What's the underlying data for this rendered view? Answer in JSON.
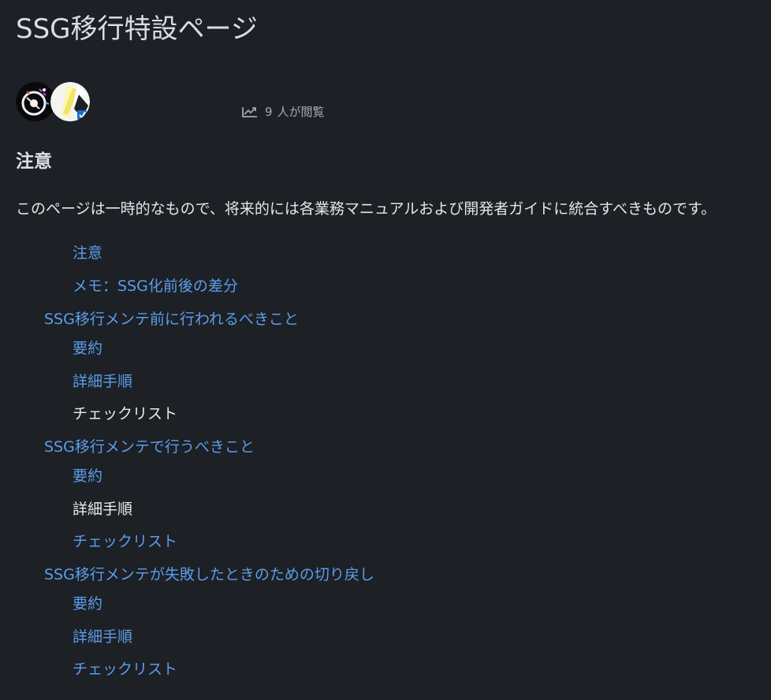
{
  "page": {
    "title": "SSG移行特設ページ"
  },
  "meta": {
    "view_count": "9",
    "view_suffix": "人が閲覧"
  },
  "notice": {
    "heading": "注意",
    "body": "このページは一時的なもので、将来的には各業務マニュアルおよび開発者ガイドに統合すべきものです。"
  },
  "toc": {
    "items": [
      {
        "label": "注意",
        "level": 2
      },
      {
        "label": "メモ：SSG化前後の差分",
        "level": 2
      },
      {
        "label": "SSG移行メンテ前に行われるべきこと",
        "level": 1
      },
      {
        "label": "要約",
        "level": 2
      },
      {
        "label": "詳細手順",
        "level": 2
      },
      {
        "label": "チェックリスト",
        "level": 2
      },
      {
        "label": "SSG移行メンテで行うべきこと",
        "level": 1
      },
      {
        "label": "要約",
        "level": 2
      },
      {
        "label": "詳細手順",
        "level": 2
      },
      {
        "label": "チェックリスト",
        "level": 2
      },
      {
        "label": "SSG移行メンテが失敗したときのための切り戻し",
        "level": 1
      },
      {
        "label": "要約",
        "level": 2
      },
      {
        "label": "詳細手順",
        "level": 2
      },
      {
        "label": "チェックリスト",
        "level": 2
      }
    ]
  },
  "colors": {
    "background": "#1d2025",
    "link": "#5b9dea",
    "text": "#e3e5e9",
    "muted": "#a4a9b0"
  },
  "icons": {
    "trend": "trending-up-icon"
  }
}
